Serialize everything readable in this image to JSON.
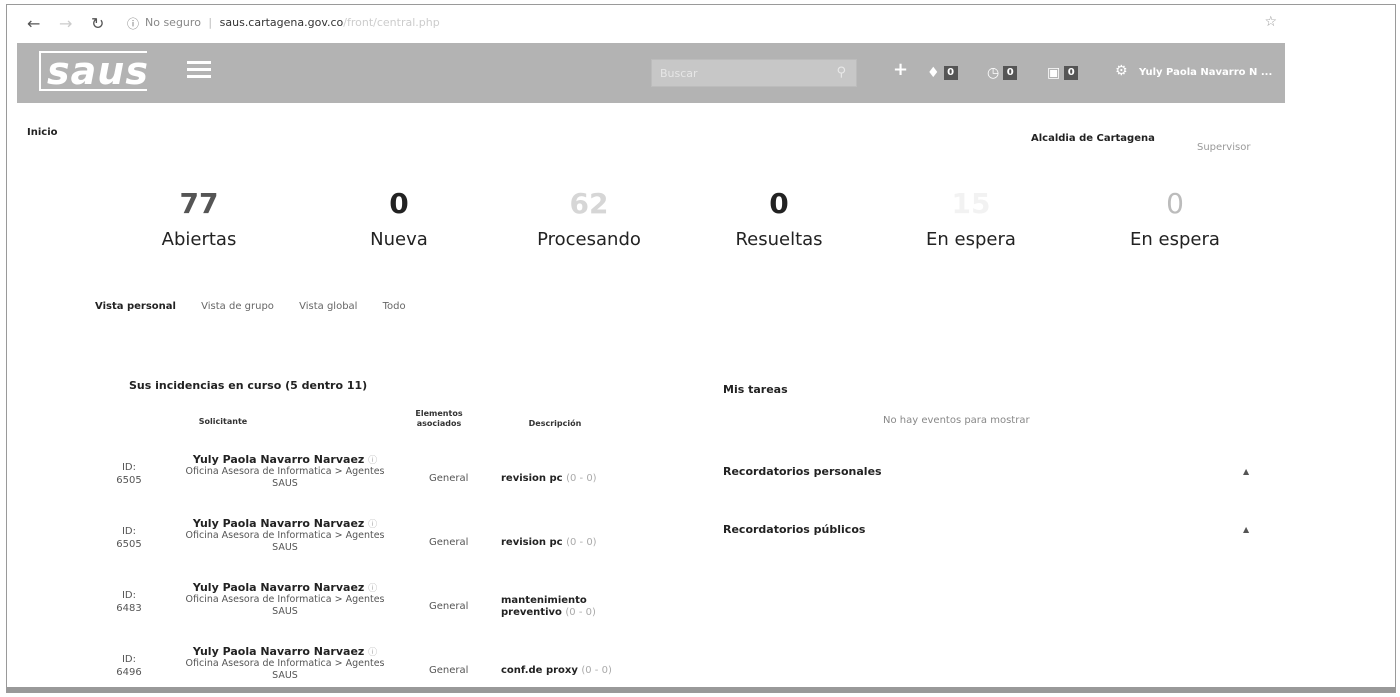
{
  "browser": {
    "security_text": "No seguro",
    "separator": "|",
    "url_host": "saus.cartagena.gov.co",
    "url_path": "/front/central.php"
  },
  "header": {
    "logo_text": "saus",
    "search_placeholder": "Buscar",
    "counters": [
      "0",
      "0",
      "0"
    ],
    "user_name": "Yuly Paola Navarro N ..."
  },
  "page": {
    "breadcrumb": "Inicio",
    "entity": "Alcaldia de Cartagena",
    "role": "Supervisor"
  },
  "stats": [
    {
      "value": "77",
      "label": "Abiertas"
    },
    {
      "value": "0",
      "label": "Nueva"
    },
    {
      "value": "62",
      "label": "Procesando"
    },
    {
      "value": "0",
      "label": "Resueltas"
    },
    {
      "value": "15",
      "label": "En espera"
    },
    {
      "value": "0",
      "label": "En espera"
    }
  ],
  "view_tabs": [
    "Vista personal",
    "Vista de grupo",
    "Vista global",
    "Todo"
  ],
  "tickets": {
    "title": "Sus incidencias en curso (5 dentro 11)",
    "columns": [
      "Solicitante",
      "Elementos asociados",
      "Descripción"
    ],
    "rows": [
      {
        "id_label": "ID:",
        "id": "6505",
        "name": "Yuly Paola Navarro Narvaez",
        "org": "Oficina Asesora de Informatica > Agentes SAUS",
        "element": "General",
        "desc": "revision pc",
        "counts": "(0 - 0)"
      },
      {
        "id_label": "ID:",
        "id": "6505",
        "name": "Yuly Paola Navarro Narvaez",
        "org": "Oficina Asesora de Informatica > Agentes SAUS",
        "element": "General",
        "desc": "revision pc",
        "counts": "(0 - 0)"
      },
      {
        "id_label": "ID:",
        "id": "6483",
        "name": "Yuly Paola Navarro Narvaez",
        "org": "Oficina Asesora de Informatica > Agentes SAUS",
        "element": "General",
        "desc": "mantenimiento preventivo",
        "counts": "(0 - 0)"
      },
      {
        "id_label": "ID:",
        "id": "6496",
        "name": "Yuly Paola Navarro Narvaez",
        "org": "Oficina Asesora de Informatica > Agentes SAUS",
        "element": "General",
        "desc": "conf.de proxy",
        "counts": "(0 - 0)"
      }
    ]
  },
  "tasks": {
    "title": "Mis tareas",
    "empty": "No hay eventos para mostrar",
    "personal_reminders": "Recordatorios personales",
    "public_reminders": "Recordatorios públicos"
  },
  "icons": [
    "back-arrow-icon",
    "forward-arrow-icon",
    "reload-icon",
    "info-icon",
    "star-icon",
    "menu-icon",
    "search-icon",
    "plus-icon",
    "tag-icon",
    "clock-icon",
    "calendar-icon",
    "gear-icon",
    "info-circle-icon",
    "expand-icon"
  ]
}
